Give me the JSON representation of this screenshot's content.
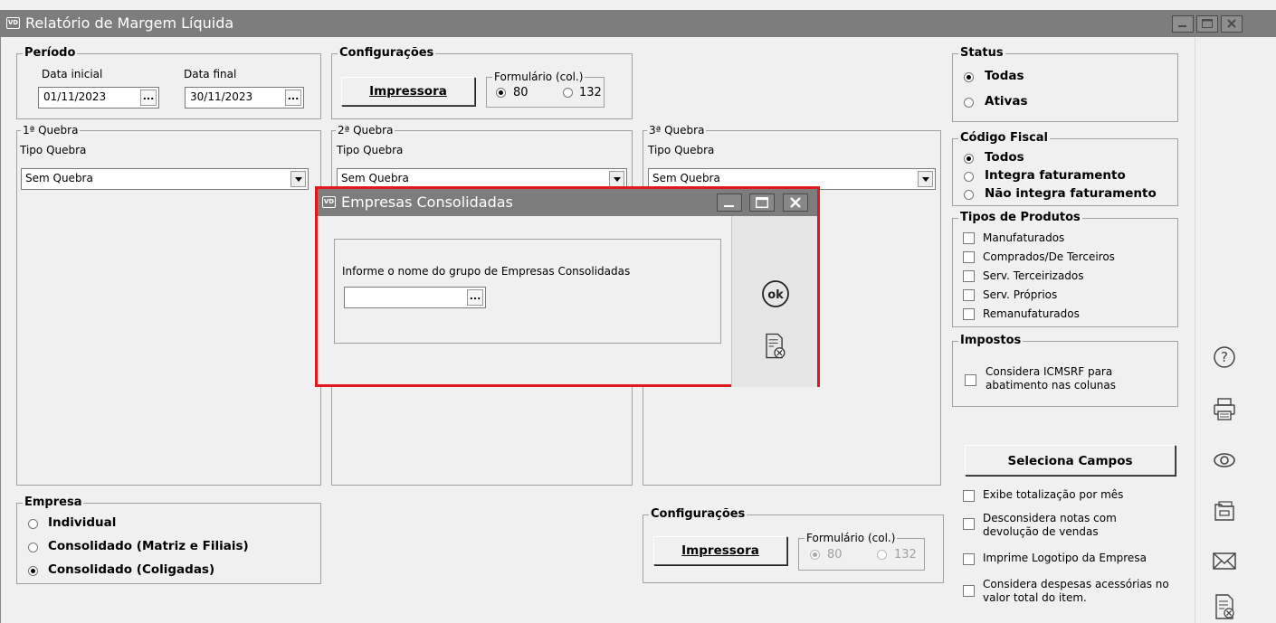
{
  "window": {
    "title": "Relatório de Margem Líquida",
    "icon": "VD"
  },
  "periodo": {
    "legend": "Período",
    "data_inicial_label": "Data inicial",
    "data_inicial": "01/11/2023",
    "data_final_label": "Data final",
    "data_final": "30/11/2023",
    "ellipsis": "..."
  },
  "config_top": {
    "legend": "Configurações",
    "button": "Impressora",
    "formulario_legend": "Formulário (col.)",
    "opt80": "80",
    "opt132": "132",
    "selected": "80"
  },
  "quebras": [
    {
      "legend": "1ª Quebra",
      "tipo_label": "Tipo Quebra",
      "value": "Sem Quebra"
    },
    {
      "legend": "2ª Quebra",
      "tipo_label": "Tipo Quebra",
      "value": "Sem Quebra"
    },
    {
      "legend": "3ª Quebra",
      "tipo_label": "Tipo Quebra",
      "value": "Sem Quebra"
    }
  ],
  "status": {
    "legend": "Status",
    "options": [
      "Todas",
      "Ativas"
    ],
    "selected": "Todas"
  },
  "codigo_fiscal": {
    "legend": "Código Fiscal",
    "options": [
      "Todos",
      "Integra faturamento",
      "Não integra faturamento"
    ],
    "selected": "Todos"
  },
  "tipos_produtos": {
    "legend": "Tipos de Produtos",
    "items": [
      "Manufaturados",
      "Comprados/De Terceiros",
      "Serv. Terceirizados",
      "Serv. Próprios",
      "Remanufaturados"
    ]
  },
  "impostos": {
    "legend": "Impostos",
    "item": "Considera ICMSRF para abatimento nas colunas"
  },
  "seleciona_campos": "Seleciona Campos",
  "options_bottom": [
    "Exibe totalização por mês",
    "Desconsidera notas com devolução de vendas",
    "Imprime Logotipo da Empresa",
    "Considera despesas acessórias no valor total do item."
  ],
  "empresa": {
    "legend": "Empresa",
    "options": [
      "Individual",
      "Consolidado (Matriz e Filiais)",
      "Consolidado (Coligadas)"
    ],
    "selected": "Consolidado (Coligadas)"
  },
  "config_bottom": {
    "legend": "Configurações",
    "button": "Impressora",
    "formulario_legend": "Formulário (col.)",
    "opt80": "80",
    "opt132": "132",
    "selected": "80"
  },
  "dialog": {
    "title": "Empresas Consolidadas",
    "icon": "VD",
    "prompt": "Informe o nome do grupo de Empresas Consolidadas",
    "value": "",
    "ok_label": "ok"
  },
  "right_toolbar": [
    "help-icon",
    "print-icon",
    "preview-icon",
    "export-icon",
    "email-icon",
    "close-report-icon"
  ],
  "colors": {
    "titlebar": "#7d7d7d",
    "highlight": "#e0191c",
    "background": "#f0f0f0"
  }
}
